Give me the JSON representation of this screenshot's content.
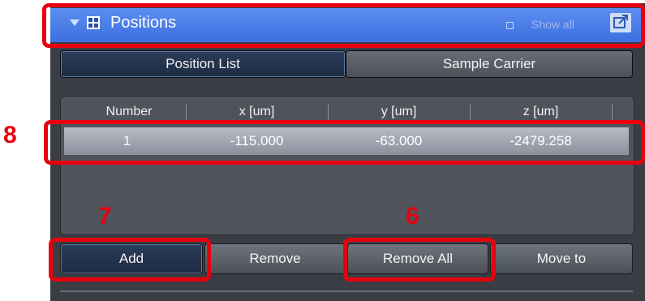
{
  "header": {
    "title": "Positions",
    "show_all_label": "Show all"
  },
  "tabs": [
    {
      "label": "Position List",
      "active": true
    },
    {
      "label": "Sample Carrier",
      "active": false
    }
  ],
  "table": {
    "columns": [
      "Number",
      "x [um]",
      "y [um]",
      "z [um]"
    ],
    "rows": [
      [
        "1",
        "-115.000",
        "-63.000",
        "-2479.258"
      ]
    ]
  },
  "buttons": {
    "add": "Add",
    "remove": "Remove",
    "remove_all": "Remove All",
    "move_to": "Move to"
  },
  "annotations": {
    "eight": "8",
    "seven": "7",
    "six": "6"
  },
  "colors": {
    "header": "#4a7de8",
    "annotation": "#e8000f"
  }
}
